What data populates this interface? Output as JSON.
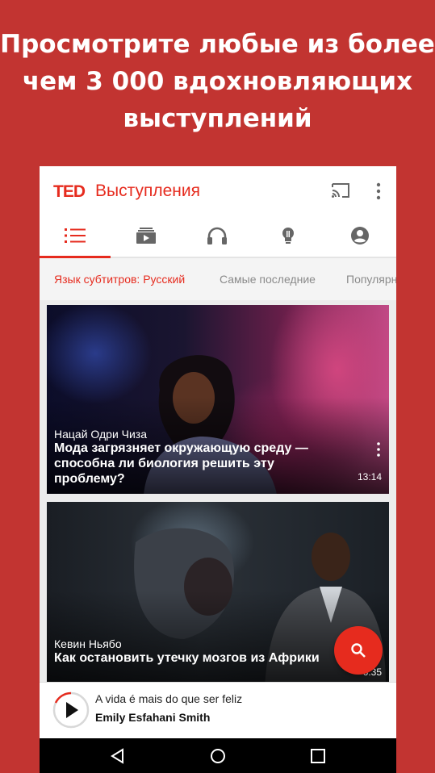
{
  "promo": {
    "line1": "Просмотрите любые из более",
    "line2": "чем 3 000 вдохновляющих",
    "line3": "выступлений"
  },
  "appbar": {
    "logo": "TED",
    "title": "Выступления",
    "accent_color": "#e62b1e"
  },
  "tabs": [
    {
      "icon": "talks-list-icon",
      "active": true
    },
    {
      "icon": "playlists-icon",
      "active": false
    },
    {
      "icon": "podcasts-headphones-icon",
      "active": false
    },
    {
      "icon": "lightbulb-icon",
      "active": false
    },
    {
      "icon": "account-icon",
      "active": false
    }
  ],
  "filters": [
    {
      "label": "Язык субтитров: Русский",
      "active": true
    },
    {
      "label": "Самые последние",
      "active": false
    },
    {
      "label": "Популярные",
      "active": false
    }
  ],
  "talks": [
    {
      "speaker": "Нацай Одри Чиза",
      "title": "Мода загрязняет окружающую среду — способна ли биология решить эту проблему?",
      "duration": "13:14"
    },
    {
      "speaker": "Кевин Ньябо",
      "title": "Как остановить утечку мозгов из Африки",
      "duration": "6:35"
    }
  ],
  "fab": {
    "icon": "search-icon"
  },
  "mini_player": {
    "talk_title": "A vida é mais do que ser feliz",
    "speaker": "Emily Esfahani Smith"
  },
  "navbar": {
    "back": "back-icon",
    "home": "home-icon",
    "recents": "recents-icon"
  }
}
